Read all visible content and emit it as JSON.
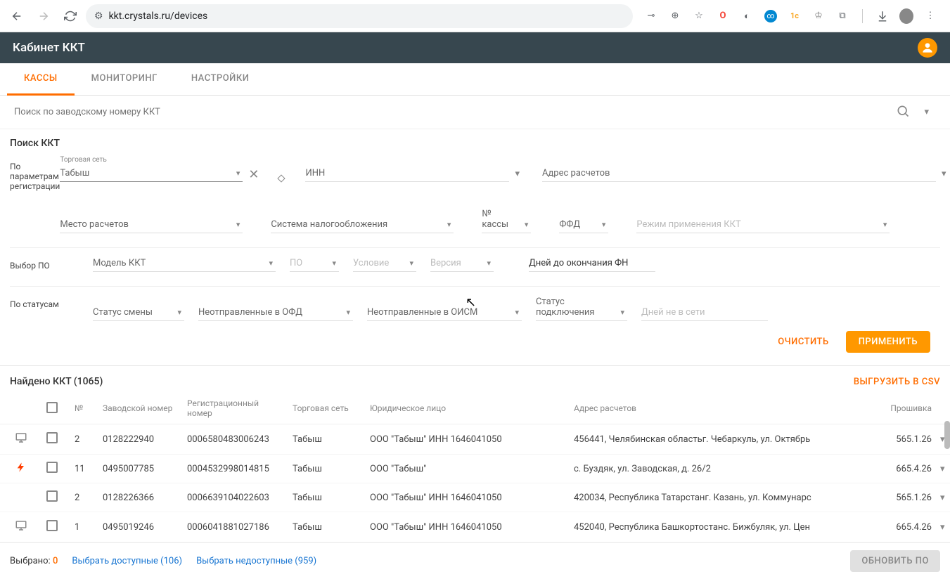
{
  "url": "kkt.crystals.ru/devices",
  "app_title": "Кабинет ККТ",
  "tabs": [
    "КАССЫ",
    "МОНИТОРИНГ",
    "НАСТРОЙКИ"
  ],
  "search_placeholder": "Поиск по заводскому номеру ККТ",
  "filter_title": "Поиск ККТ",
  "filters": {
    "row1_label": "По параметрам регистрации",
    "network_label": "Торговая сеть",
    "network_value": "Табыш",
    "inn": "ИНН",
    "address": "Адрес расчетов",
    "place": "Место расчетов",
    "tax": "Система налогообложения",
    "cash_num": "№ кассы",
    "ffd": "ФФД",
    "mode": "Режим применения ККТ",
    "row2_label": "Выбор ПО",
    "model": "Модель ККТ",
    "software": "ПО",
    "condition": "Условие",
    "version": "Версия",
    "fn_days": "Дней до окончания ФН",
    "row3_label": "По статусам",
    "shift_status": "Статус смены",
    "ofd": "Неотправленные в ОФД",
    "oism": "Неотправленные в ОИСМ",
    "conn_status": "Статус подключения",
    "offline_days": "Дней не в сети"
  },
  "btn_clear": "ОЧИСТИТЬ",
  "btn_apply": "ПРИМЕНИТЬ",
  "results_title": "Найдено ККТ (1065)",
  "export_csv": "ВЫГРУЗИТЬ В CSV",
  "columns": {
    "num": "№",
    "factory": "Заводской номер",
    "reg": "Регистрационный номер",
    "network": "Торговая сеть",
    "legal": "Юридическое лицо",
    "address": "Адрес расчетов",
    "firmware": "Прошивка"
  },
  "rows": [
    {
      "icon": "monitor",
      "num": "2",
      "factory": "0128222940",
      "reg": "0006580483006243",
      "network": "Табыш",
      "legal": "ООО \"Табыш\" ИНН 1646041050",
      "address": "456441, Челябинская областьг. Чебаркуль, ул. Октябрь",
      "fw": "565.1.26"
    },
    {
      "icon": "bolt",
      "num": "11",
      "factory": "0495007785",
      "reg": "0004532998014815",
      "network": "Табыш",
      "legal": "ООО \"Табыш\"",
      "address": "с. Буздяк, ул. Заводская, д. 26/2",
      "fw": "665.4.26"
    },
    {
      "icon": "",
      "num": "2",
      "factory": "0128226366",
      "reg": "0006639104022603",
      "network": "Табыш",
      "legal": "ООО \"Табыш\" ИНН 1646041050",
      "address": "420034, Республика Татарстанг. Казань, ул. Коммунарс",
      "fw": "565.1.26"
    },
    {
      "icon": "monitor",
      "num": "1",
      "factory": "0495019246",
      "reg": "0006041881027186",
      "network": "Табыш",
      "legal": "ООО \"Табыш\" ИНН 1646041050",
      "address": "452040, Республика Башкортостанс. Бижбуляк, ул. Цен",
      "fw": "665.4.26"
    }
  ],
  "footer": {
    "selected_label": "Выбрано:",
    "selected_count": "0",
    "avail": "Выбрать доступные (106)",
    "unavail": "Выбрать недоступные (959)",
    "update": "ОБНОВИТЬ ПО"
  }
}
